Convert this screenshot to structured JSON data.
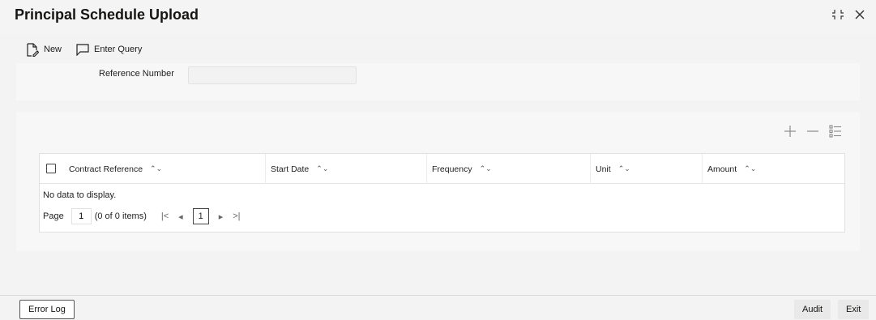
{
  "window": {
    "title": "Principal Schedule Upload",
    "collapse_icon": "collapse-arrows-icon",
    "close_icon": "close-icon"
  },
  "toolbar": {
    "new_label": "New",
    "new_icon": "new-document-icon",
    "enter_query_label": "Enter Query",
    "enter_query_icon": "query-comment-icon"
  },
  "form": {
    "reference_label": "Reference Number",
    "reference_value": ""
  },
  "grid": {
    "tools": [
      "add-icon",
      "remove-icon",
      "column-settings-icon"
    ],
    "columns": [
      "Contract Reference",
      "Start Date",
      "Frequency",
      "Unit",
      "Amount"
    ],
    "empty_message": "No data to display.",
    "pager": {
      "page_label": "Page",
      "page_value": "1",
      "count_text": "(0 of 0 items)",
      "current_page": "1",
      "first": "|<",
      "prev": "◂",
      "next": "▸",
      "last": ">|"
    }
  },
  "footer": {
    "error_log_label": "Error Log",
    "audit_label": "Audit",
    "exit_label": "Exit"
  },
  "colors": {
    "background": "#f3f3f3",
    "panel": "#f7f7f7",
    "table": "#ffffff",
    "text": "#161513"
  }
}
